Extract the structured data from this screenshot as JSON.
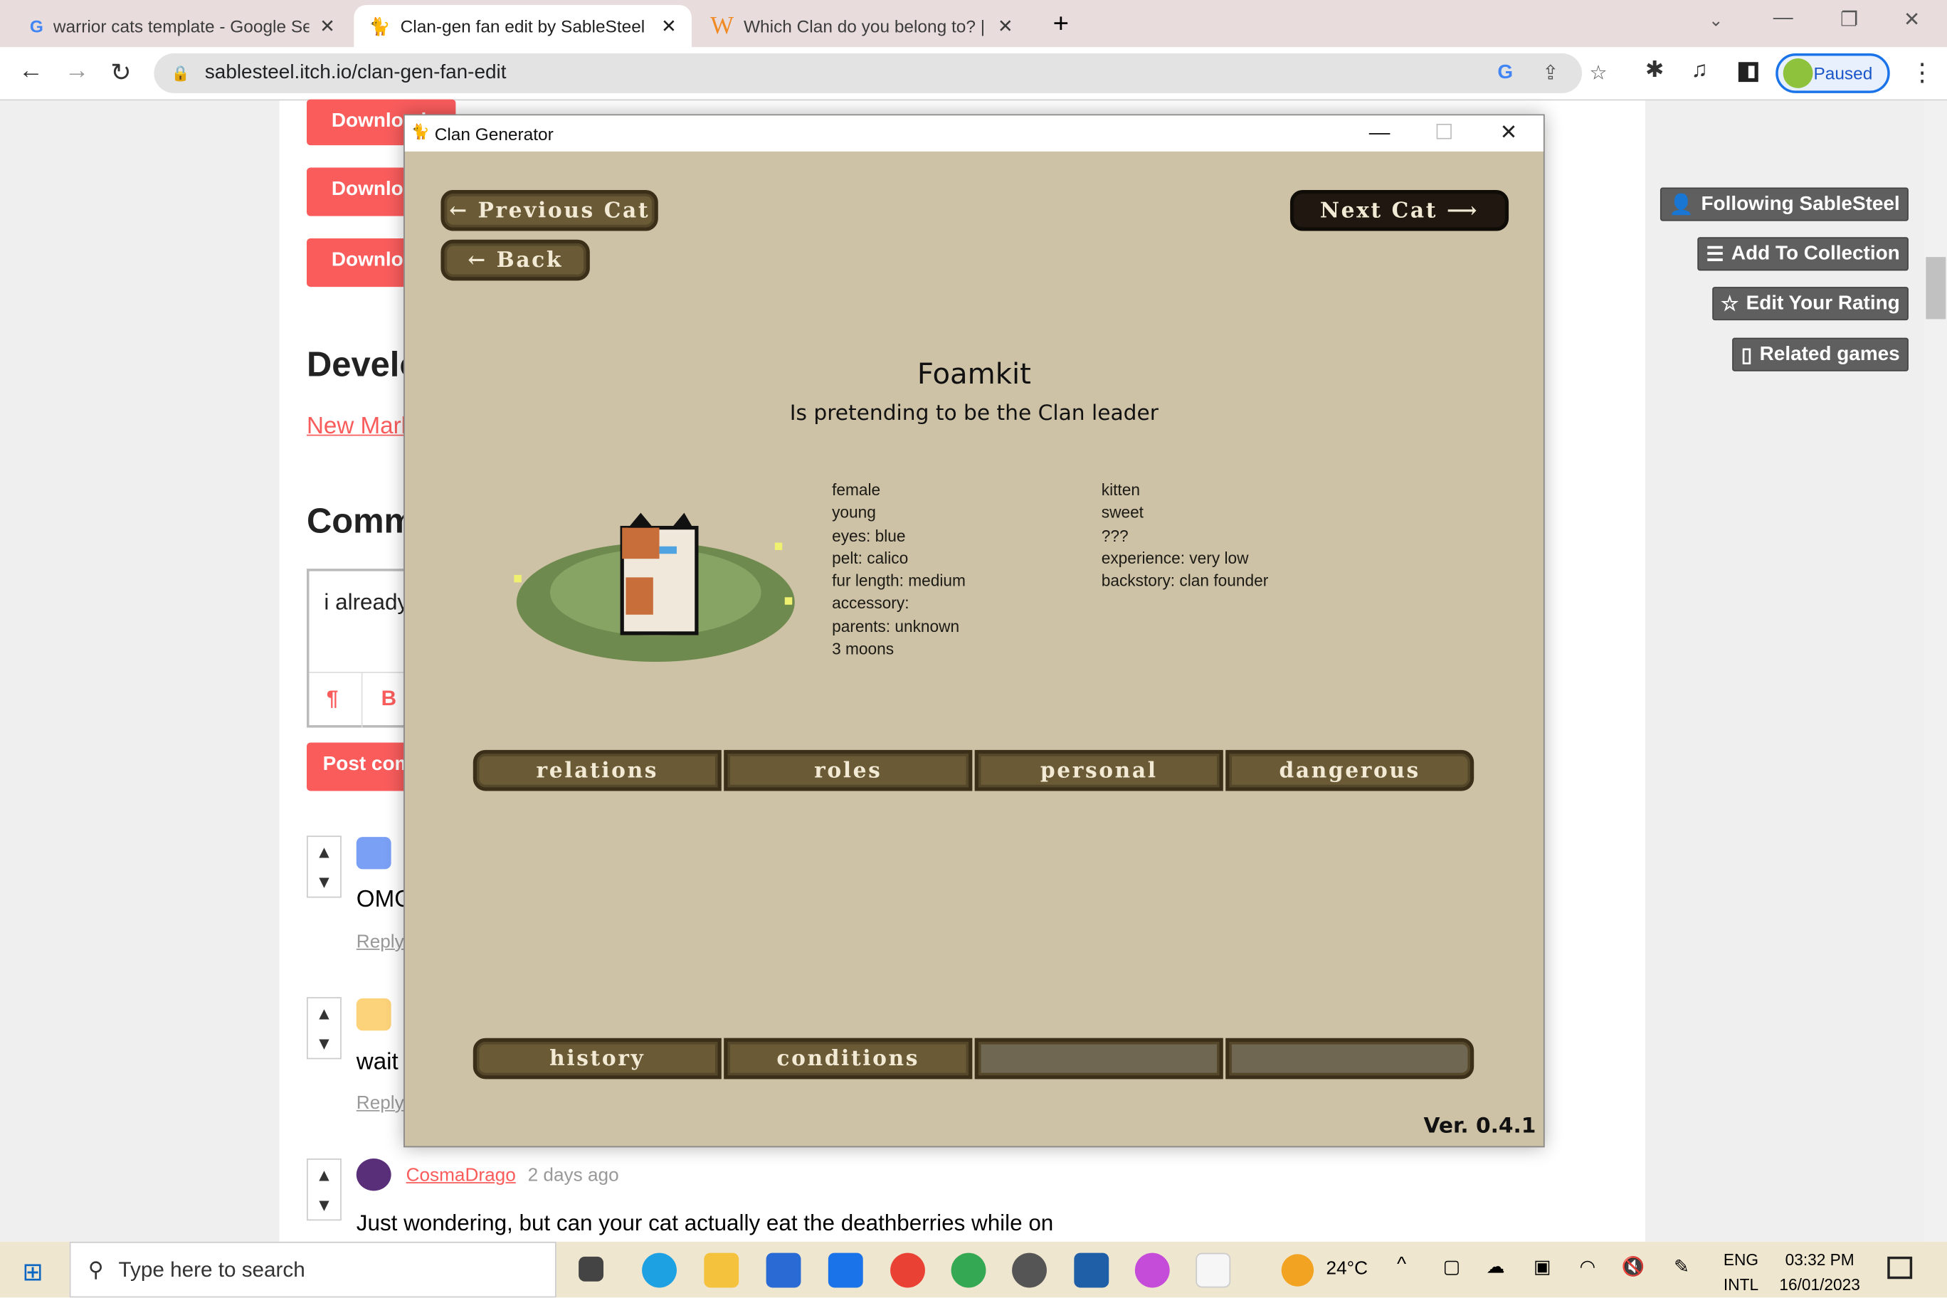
{
  "browser": {
    "tabs": [
      {
        "title": "warrior cats template - Google Search",
        "icon": "google-icon",
        "active": false
      },
      {
        "title": "Clan-gen fan edit by SableSteel",
        "icon": "cat-icon",
        "active": true
      },
      {
        "title": "Which Clan do you belong to? | Warriors",
        "icon": "w-icon",
        "active": false
      }
    ],
    "url": "sablesteel.itch.io/clan-gen-fan-edit",
    "profile_status": "Paused"
  },
  "page": {
    "download_label": "Download",
    "dev_heading": "Development log",
    "devlog_link": "New Mark",
    "comments_heading": "Comments",
    "comment_draft": "i already",
    "format_buttons": [
      "¶",
      "B"
    ],
    "post_button": "Post comment",
    "comments": [
      {
        "text": "OMG",
        "reply": "Reply",
        "avatar_color": "#7aa0f5"
      },
      {
        "text": "wait",
        "reply": "Reply",
        "avatar_color": "#fcd27a"
      },
      {
        "author": "CosmaDrago",
        "time": "2 days ago",
        "text": "Just wondering, but can your cat actually eat the deathberries while on"
      }
    ],
    "sidebar_buttons": [
      {
        "label": "Following SableSteel",
        "icon": "user-check-icon"
      },
      {
        "label": "Add To Collection",
        "icon": "add-list-icon"
      },
      {
        "label": "Edit Your Rating",
        "icon": "star-icon"
      },
      {
        "label": "Related games",
        "icon": "map-icon"
      }
    ]
  },
  "game": {
    "window_title": "Clan Generator",
    "prev_button": "Previous Cat",
    "back_button": "Back",
    "next_button": "Next Cat",
    "cat": {
      "name": "Foamkit",
      "status": "Is pretending to be the Clan leader",
      "info_left": [
        "female",
        "young",
        "eyes: blue",
        "pelt: calico",
        "fur length: medium",
        "accessory:",
        "parents: unknown",
        "3 moons"
      ],
      "info_right": [
        "kitten",
        "sweet",
        "???",
        "experience: very low",
        "backstory: clan founder"
      ]
    },
    "tabs_row1": [
      "relations",
      "roles",
      "personal",
      "dangerous"
    ],
    "tabs_row2": [
      "history",
      "conditions",
      "",
      ""
    ],
    "version": "Ver. 0.4.1",
    "colors": {
      "background": "#cdc1a6",
      "button": "#6a5a36",
      "button_dark": "#201810"
    }
  },
  "taskbar": {
    "search_placeholder": "Type here to search",
    "temperature": "24°C",
    "lang1": "ENG",
    "lang2": "INTL",
    "time": "03:32 PM",
    "date": "16/01/2023"
  }
}
